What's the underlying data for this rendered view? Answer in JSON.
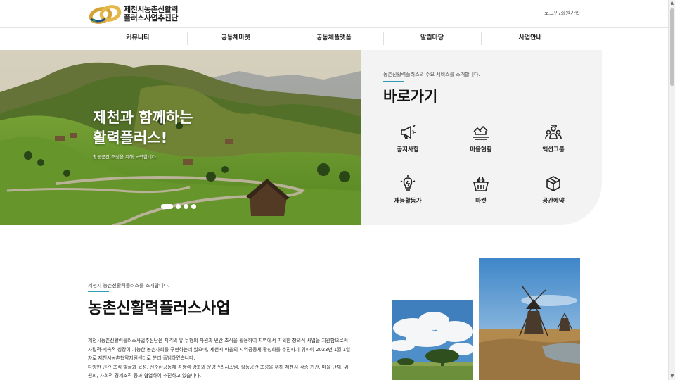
{
  "header": {
    "logo_line1": "제천시농촌신활력",
    "logo_line2": "플러스사업추진단",
    "login": "로그인",
    "separator": "/",
    "signup": "회원가입"
  },
  "nav": {
    "items": [
      "커뮤니티",
      "공동체마켓",
      "공동체플랫폼",
      "알림마당",
      "사업안내"
    ]
  },
  "hero": {
    "title_line1": "제천과 함께하는",
    "title_line2": "활력플러스!",
    "subtitle": "활동공간 조성을 위해 노력합니다.",
    "slides": 4,
    "active_slide": 1
  },
  "quick": {
    "intro": "농촌신활력플러스의 주요 서비스를 소개합니다.",
    "title": "바로가기",
    "items": [
      {
        "label": "공지사항",
        "icon": "megaphone-icon"
      },
      {
        "label": "마을현황",
        "icon": "village-icon"
      },
      {
        "label": "액션그룹",
        "icon": "group-icon"
      },
      {
        "label": "재능활동가",
        "icon": "lightbulb-icon"
      },
      {
        "label": "마켓",
        "icon": "basket-icon"
      },
      {
        "label": "공간예약",
        "icon": "box-icon"
      }
    ]
  },
  "intro": {
    "subtitle": "제천시 농촌신활력플러스를 소개합니다.",
    "title": "농촌신활력플러스사업",
    "body_lines": [
      "제천시농촌신활력플러스사업추진단은 지역의 유·무형의 자원과 민간 조직을 활용하여 지역에서 기획한 창의적 사업을 지원함으로써",
      "자립적·지속적 성장이 가능한 농촌사회를 구현하는데 있으며, 제천시 마을의 지역공동체 활성화를 추진하기 위하여 2023년 1월 1일",
      "자로 제천시농촌협약지원센터로 분리·출범하였습니다.",
      "다양한 민간 조직 발굴과 육성, 선순환공동체 경쟁력 강화와 운영관리시스템, 활동공간 조성을 위해 제천시 각종 기관, 마을 단체, 위",
      "원회, 사회적 경제조직 등과 협업하여 추진하고 있습니다."
    ]
  },
  "colors": {
    "accent": "#2f9bb6",
    "panel": "#f3f3f3",
    "logo_gold": "#d6a338",
    "logo_blue": "#1f4e8a"
  }
}
